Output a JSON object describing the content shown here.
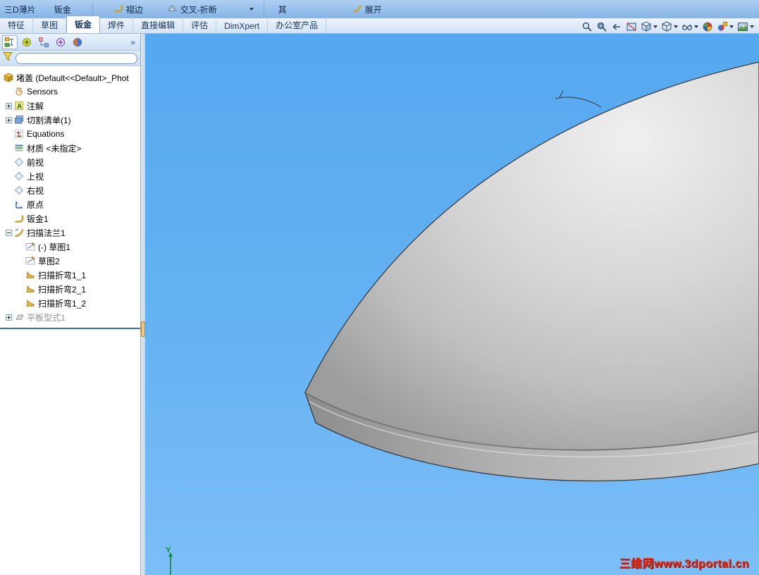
{
  "ribbon": {
    "items": [
      {
        "label": "三D薄片"
      },
      {
        "label": "钣金"
      },
      {
        "label": "褶边"
      },
      {
        "label": "交叉-折断"
      },
      {
        "label": "其"
      },
      {
        "label": "展开"
      }
    ]
  },
  "tab_bar": {
    "tabs": [
      {
        "label": "特征"
      },
      {
        "label": "草图"
      },
      {
        "label": "钣金"
      },
      {
        "label": "焊件"
      },
      {
        "label": "直接编辑"
      },
      {
        "label": "评估"
      },
      {
        "label": "DimXpert"
      },
      {
        "label": "办公室产品"
      }
    ],
    "active_tab": "钣金"
  },
  "view_toolbar": {
    "icons": [
      "zoom-to-fit",
      "zoom-to-area",
      "previous-view",
      "section-view",
      "view-orientation",
      "display-style",
      "hide-show-items",
      "appearances",
      "edit-appearance",
      "apply-scene"
    ]
  },
  "panel": {
    "overflow_glyph": "»",
    "filter_value": "",
    "tree": {
      "root": {
        "label": "堵盖  (Default<<Default>_Phot"
      },
      "items": [
        {
          "label": "Sensors"
        },
        {
          "label": "注解"
        },
        {
          "label": "切割清单(1)"
        },
        {
          "label": "Equations"
        },
        {
          "label": "材质 <未指定>"
        },
        {
          "label": "前视"
        },
        {
          "label": "上视"
        },
        {
          "label": "右视"
        },
        {
          "label": "原点"
        },
        {
          "label": "钣金1"
        },
        {
          "label": "扫描法兰1"
        },
        {
          "label": "(-) 草图1"
        },
        {
          "label": "草图2"
        },
        {
          "label": "扫描折弯1_1"
        },
        {
          "label": "扫描折弯2_1"
        },
        {
          "label": "扫描折弯1_2"
        },
        {
          "label": "平板型式1"
        }
      ]
    }
  },
  "viewport": {
    "triad_y_label": "Y",
    "watermark": "三维网www.3dportal.cn",
    "background_top": "#55a8ef",
    "background_bottom": "#7cbef7",
    "model_color": "#c9c9c9"
  }
}
